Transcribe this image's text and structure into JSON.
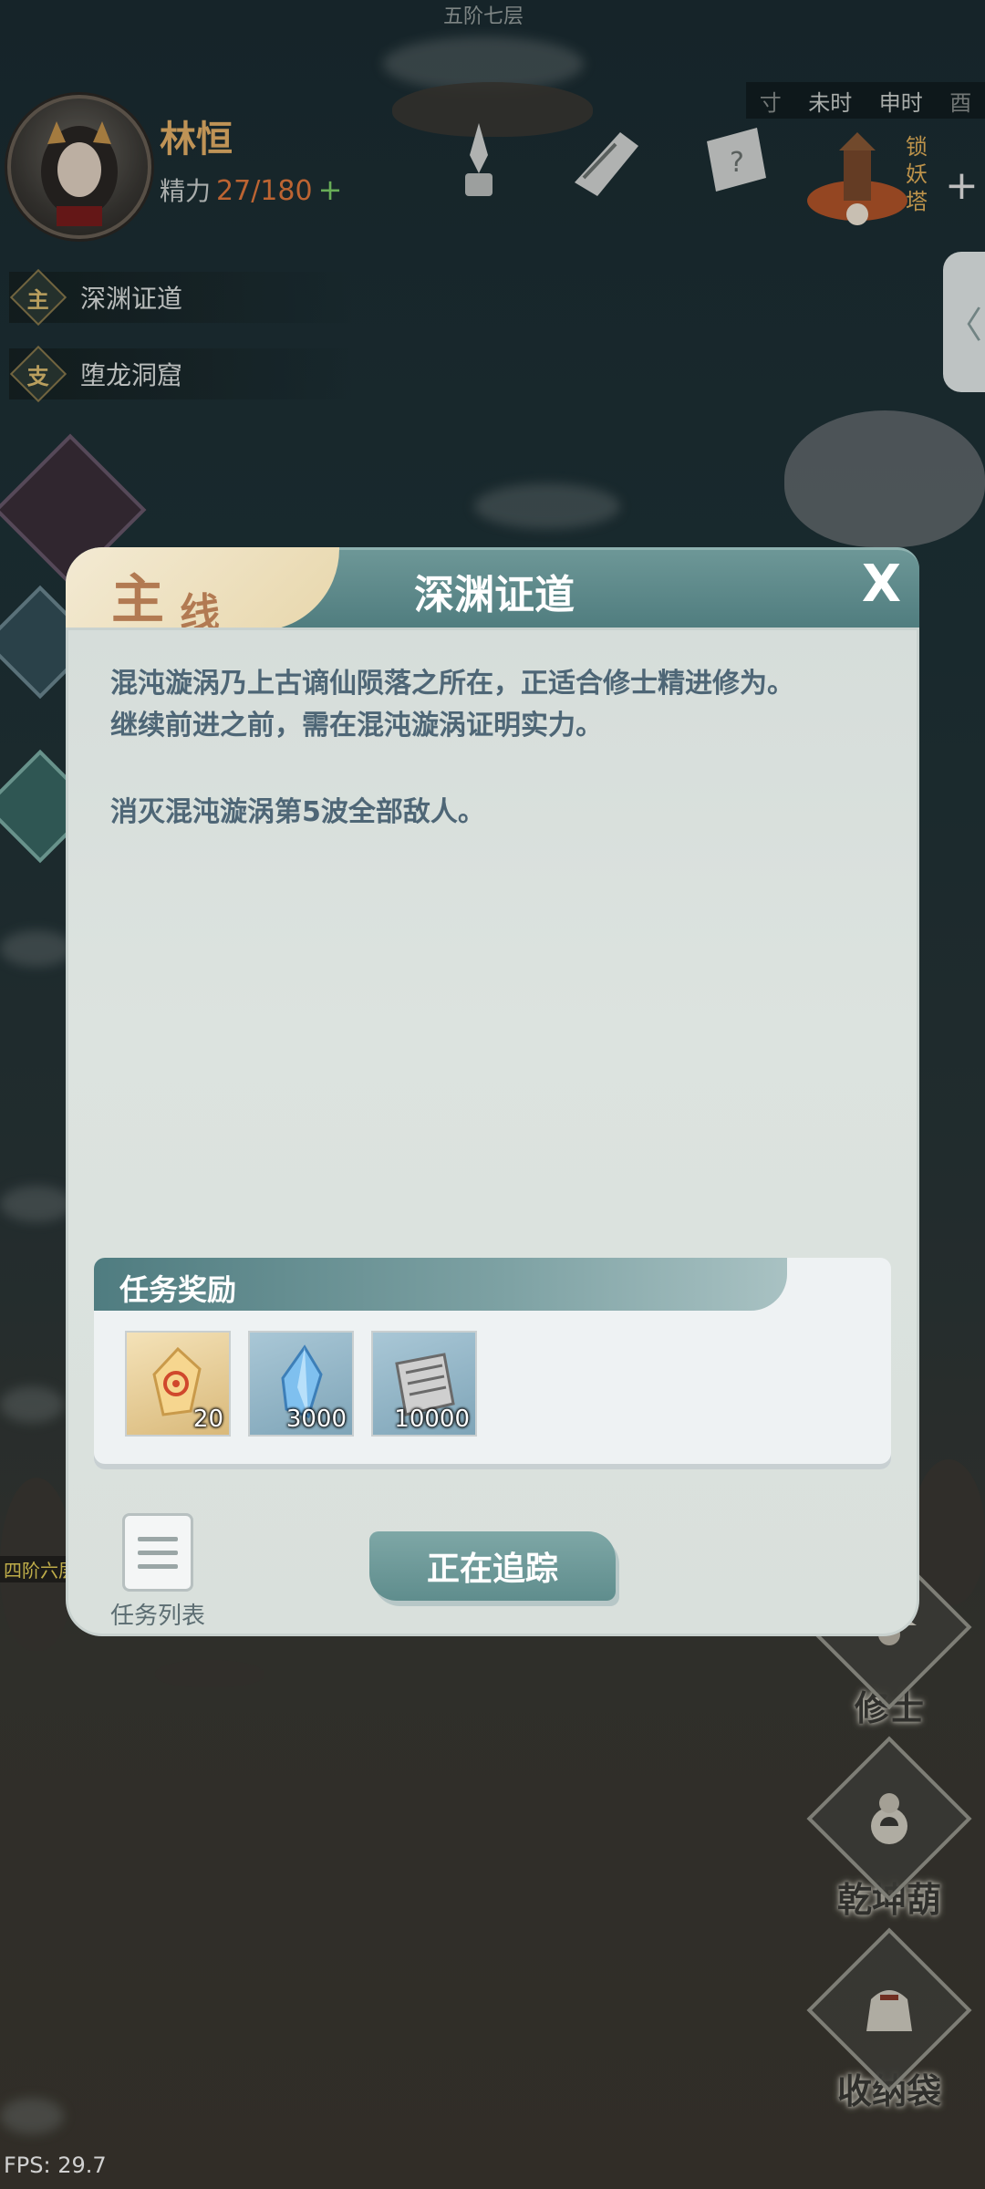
{
  "hud": {
    "top_floor_label": "五阶七层",
    "player_name": "林恒",
    "energy_label": "精力",
    "energy_value": "27/180",
    "energy_plus": "+",
    "quests": [
      {
        "badge": "主",
        "label": "深渊证道"
      },
      {
        "badge": "支",
        "label": "堕龙洞窟"
      }
    ],
    "time_bar": {
      "left": "寸",
      "t1": "未时",
      "t2": "申时",
      "right": "酉"
    },
    "pagoda_label": "锁妖塔",
    "plus": "+",
    "side_tab_glyph": "〈",
    "left_floor_label": "四阶六层",
    "fps": "FPS: 29.7"
  },
  "right_buttons": [
    {
      "label": "修士",
      "icon": "cultivator-icon"
    },
    {
      "label": "乾坤葫",
      "icon": "gourd-icon"
    },
    {
      "label": "收纳袋",
      "icon": "bag-icon"
    }
  ],
  "dialog": {
    "tag_big": "主",
    "tag_small": "线",
    "title": "深渊证道",
    "close": "X",
    "description_line1": "混沌漩涡乃上古谪仙陨落之所在，正适合修士精进修为。",
    "description_line2": "继续前进之前，需在混沌漩涡证明实力。",
    "objective": "消灭混沌漩涡第5波全部敌人。",
    "reward_title": "任务奖励",
    "rewards": [
      {
        "icon": "talisman-crystal-icon",
        "count": "20"
      },
      {
        "icon": "spirit-stone-icon",
        "count": "3000"
      },
      {
        "icon": "scroll-icon",
        "count": "10000"
      }
    ],
    "task_list_label": "任务列表",
    "track_button": "正在追踪"
  }
}
